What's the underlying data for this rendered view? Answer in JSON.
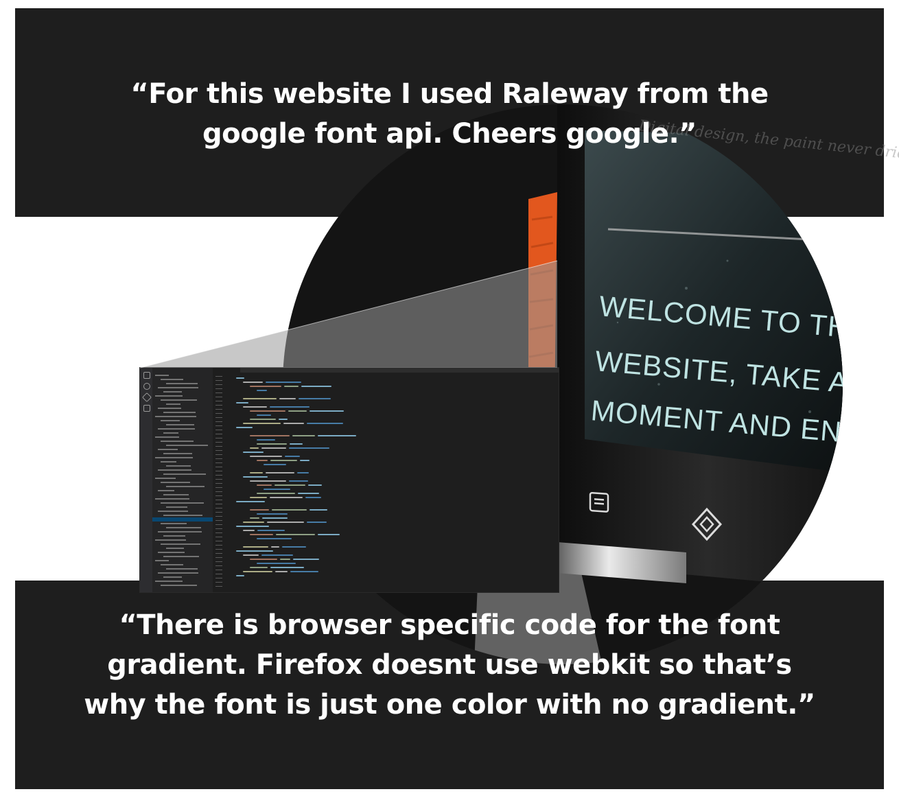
{
  "quotes": {
    "top": "“For this website I used Raleway from the google font api. Cheers google.”",
    "bottom": "“There is browser specific code for the font gradient.  Firefox doesnt use webkit so that’s why the font is just one color with no gradient.”"
  },
  "device": {
    "screen_heading": "WELCOME TO THIS WEBSITE, TAKE A MOMENT AND ENJOY, MY",
    "faint_tagline": "Digital design, the paint never dries.",
    "menu_icon": "menu-icon",
    "logo_icon": "diamond-logo-icon"
  },
  "editor": {
    "sidebar_icons": [
      "files-icon",
      "search-icon",
      "git-icon",
      "extensions-icon"
    ]
  },
  "colors": {
    "band": "#1e1e1e",
    "accent_orange": "#e2571e",
    "screen_text": "#bfe3e2"
  }
}
